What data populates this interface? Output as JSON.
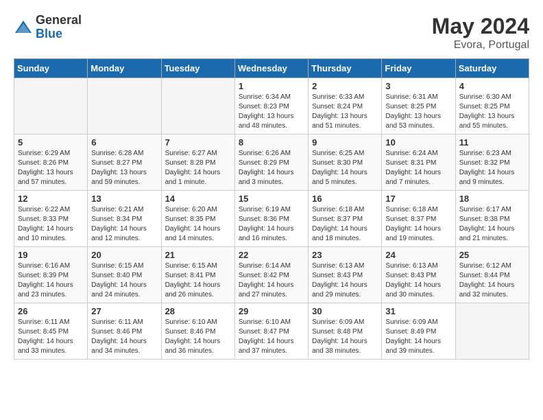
{
  "logo": {
    "general": "General",
    "blue": "Blue"
  },
  "title": {
    "month_year": "May 2024",
    "location": "Evora, Portugal"
  },
  "weekdays": [
    "Sunday",
    "Monday",
    "Tuesday",
    "Wednesday",
    "Thursday",
    "Friday",
    "Saturday"
  ],
  "weeks": [
    [
      {
        "day": "",
        "empty": true
      },
      {
        "day": "",
        "empty": true
      },
      {
        "day": "",
        "empty": true
      },
      {
        "day": "1",
        "sunrise": "6:34 AM",
        "sunset": "8:23 PM",
        "daylight": "13 hours and 48 minutes."
      },
      {
        "day": "2",
        "sunrise": "6:33 AM",
        "sunset": "8:24 PM",
        "daylight": "13 hours and 51 minutes."
      },
      {
        "day": "3",
        "sunrise": "6:31 AM",
        "sunset": "8:25 PM",
        "daylight": "13 hours and 53 minutes."
      },
      {
        "day": "4",
        "sunrise": "6:30 AM",
        "sunset": "8:25 PM",
        "daylight": "13 hours and 55 minutes."
      }
    ],
    [
      {
        "day": "5",
        "sunrise": "6:29 AM",
        "sunset": "8:26 PM",
        "daylight": "13 hours and 57 minutes."
      },
      {
        "day": "6",
        "sunrise": "6:28 AM",
        "sunset": "8:27 PM",
        "daylight": "13 hours and 59 minutes."
      },
      {
        "day": "7",
        "sunrise": "6:27 AM",
        "sunset": "8:28 PM",
        "daylight": "14 hours and 1 minute."
      },
      {
        "day": "8",
        "sunrise": "6:26 AM",
        "sunset": "8:29 PM",
        "daylight": "14 hours and 3 minutes."
      },
      {
        "day": "9",
        "sunrise": "6:25 AM",
        "sunset": "8:30 PM",
        "daylight": "14 hours and 5 minutes."
      },
      {
        "day": "10",
        "sunrise": "6:24 AM",
        "sunset": "8:31 PM",
        "daylight": "14 hours and 7 minutes."
      },
      {
        "day": "11",
        "sunrise": "6:23 AM",
        "sunset": "8:32 PM",
        "daylight": "14 hours and 9 minutes."
      }
    ],
    [
      {
        "day": "12",
        "sunrise": "6:22 AM",
        "sunset": "8:33 PM",
        "daylight": "14 hours and 10 minutes."
      },
      {
        "day": "13",
        "sunrise": "6:21 AM",
        "sunset": "8:34 PM",
        "daylight": "14 hours and 12 minutes."
      },
      {
        "day": "14",
        "sunrise": "6:20 AM",
        "sunset": "8:35 PM",
        "daylight": "14 hours and 14 minutes."
      },
      {
        "day": "15",
        "sunrise": "6:19 AM",
        "sunset": "8:36 PM",
        "daylight": "14 hours and 16 minutes."
      },
      {
        "day": "16",
        "sunrise": "6:18 AM",
        "sunset": "8:37 PM",
        "daylight": "14 hours and 18 minutes."
      },
      {
        "day": "17",
        "sunrise": "6:18 AM",
        "sunset": "8:37 PM",
        "daylight": "14 hours and 19 minutes."
      },
      {
        "day": "18",
        "sunrise": "6:17 AM",
        "sunset": "8:38 PM",
        "daylight": "14 hours and 21 minutes."
      }
    ],
    [
      {
        "day": "19",
        "sunrise": "6:16 AM",
        "sunset": "8:39 PM",
        "daylight": "14 hours and 23 minutes."
      },
      {
        "day": "20",
        "sunrise": "6:15 AM",
        "sunset": "8:40 PM",
        "daylight": "14 hours and 24 minutes."
      },
      {
        "day": "21",
        "sunrise": "6:15 AM",
        "sunset": "8:41 PM",
        "daylight": "14 hours and 26 minutes."
      },
      {
        "day": "22",
        "sunrise": "6:14 AM",
        "sunset": "8:42 PM",
        "daylight": "14 hours and 27 minutes."
      },
      {
        "day": "23",
        "sunrise": "6:13 AM",
        "sunset": "8:43 PM",
        "daylight": "14 hours and 29 minutes."
      },
      {
        "day": "24",
        "sunrise": "6:13 AM",
        "sunset": "8:43 PM",
        "daylight": "14 hours and 30 minutes."
      },
      {
        "day": "25",
        "sunrise": "6:12 AM",
        "sunset": "8:44 PM",
        "daylight": "14 hours and 32 minutes."
      }
    ],
    [
      {
        "day": "26",
        "sunrise": "6:11 AM",
        "sunset": "8:45 PM",
        "daylight": "14 hours and 33 minutes."
      },
      {
        "day": "27",
        "sunrise": "6:11 AM",
        "sunset": "8:46 PM",
        "daylight": "14 hours and 34 minutes."
      },
      {
        "day": "28",
        "sunrise": "6:10 AM",
        "sunset": "8:46 PM",
        "daylight": "14 hours and 36 minutes."
      },
      {
        "day": "29",
        "sunrise": "6:10 AM",
        "sunset": "8:47 PM",
        "daylight": "14 hours and 37 minutes."
      },
      {
        "day": "30",
        "sunrise": "6:09 AM",
        "sunset": "8:48 PM",
        "daylight": "14 hours and 38 minutes."
      },
      {
        "day": "31",
        "sunrise": "6:09 AM",
        "sunset": "8:49 PM",
        "daylight": "14 hours and 39 minutes."
      },
      {
        "day": "",
        "empty": true
      }
    ]
  ]
}
